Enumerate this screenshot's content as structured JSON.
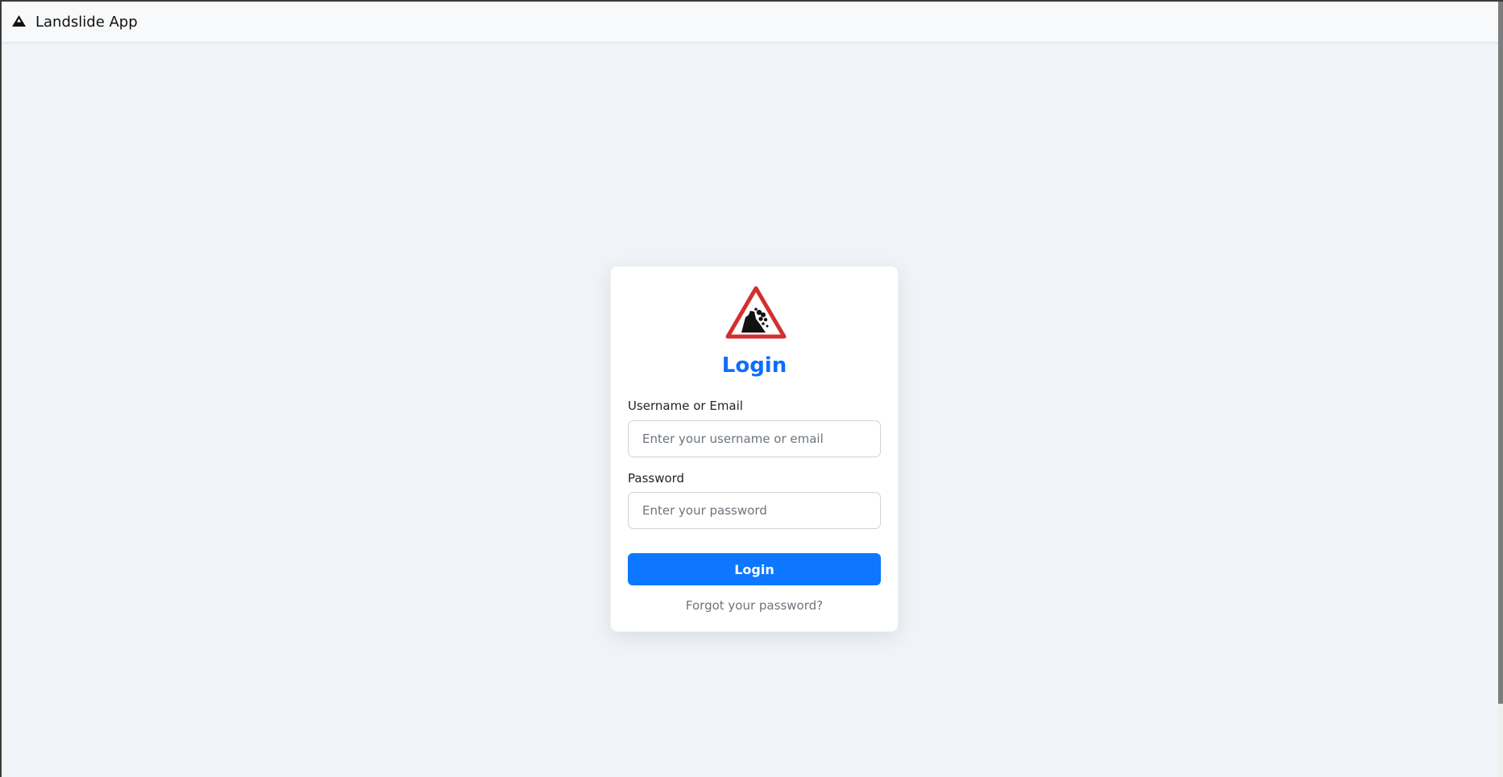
{
  "navbar": {
    "brand_text": "Landslide App",
    "brand_icon": "mountain-icon"
  },
  "login_card": {
    "logo_icon": "landslide-warning-sign-icon",
    "title": "Login",
    "username": {
      "label": "Username or Email",
      "placeholder": "Enter your username or email",
      "value": ""
    },
    "password": {
      "label": "Password",
      "placeholder": "Enter your password",
      "value": ""
    },
    "submit_label": "Login",
    "forgot_link": "Forgot your password?"
  },
  "colors": {
    "accent": "#0d6efd",
    "button": "#0d78ff",
    "warning_red": "#d32f2f",
    "background": "#f0f3f7"
  }
}
